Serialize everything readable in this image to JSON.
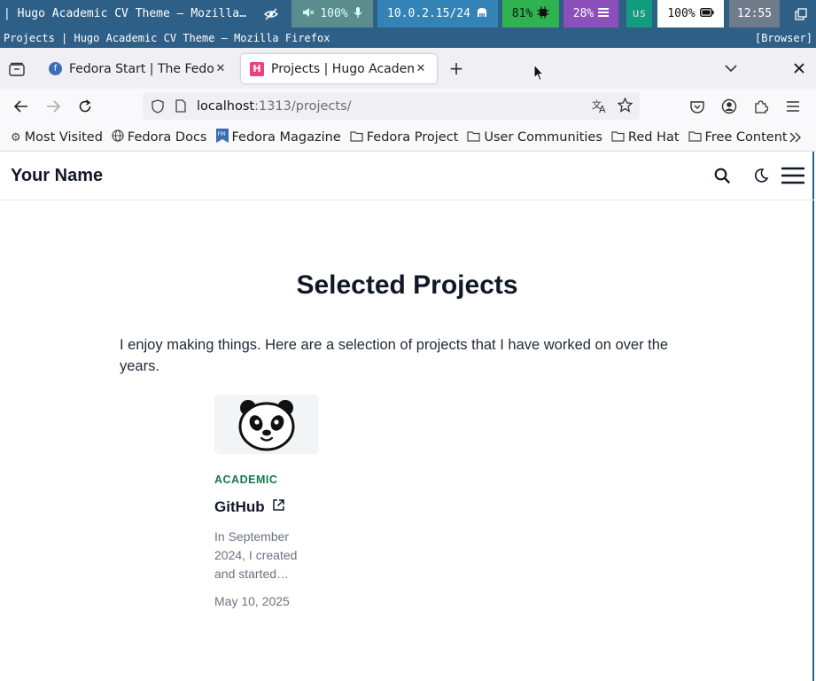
{
  "statusbar": {
    "window_title": "| Hugo Academic CV Theme — Mozilla…",
    "audio": "100%",
    "network": "10.0.2.15/24",
    "cpu": "81%",
    "memory": "28%",
    "keyboard": "us",
    "battery": "100%",
    "clock": "12:55"
  },
  "window": {
    "title": "Projects | Hugo Academic CV Theme — Mozilla Firefox",
    "tag": "[Browser]"
  },
  "tabs": [
    {
      "label": "Fedora Start | The Fedora",
      "icon": "fedora-icon",
      "active": false
    },
    {
      "label": "Projects | Hugo Academic",
      "icon": "hugo-icon",
      "active": true
    }
  ],
  "urlbar": {
    "host": "localhost",
    "path": ":1313/projects/"
  },
  "bookmarks": [
    {
      "label": "Most Visited",
      "icon": "gear-icon"
    },
    {
      "label": "Fedora Docs",
      "icon": "globe-icon"
    },
    {
      "label": "Fedora Magazine",
      "icon": "fm-icon"
    },
    {
      "label": "Fedora Project",
      "icon": "folder-icon"
    },
    {
      "label": "User Communities",
      "icon": "folder-icon"
    },
    {
      "label": "Red Hat",
      "icon": "folder-icon"
    },
    {
      "label": "Free Content",
      "icon": "folder-icon"
    }
  ],
  "site": {
    "brand": "Your Name",
    "page_title": "Selected Projects",
    "intro": "I enjoy making things. Here are a selection of projects that I have worked on over the years.",
    "card": {
      "category": "ACADEMIC",
      "title": "GitHub",
      "summary": "In September 2024, I created and started…",
      "date": "May 10, 2025"
    }
  },
  "colors": {
    "i3_bar": "#2e5f86",
    "category_green": "#137a4c",
    "hugo_pink": "#e9437e"
  }
}
